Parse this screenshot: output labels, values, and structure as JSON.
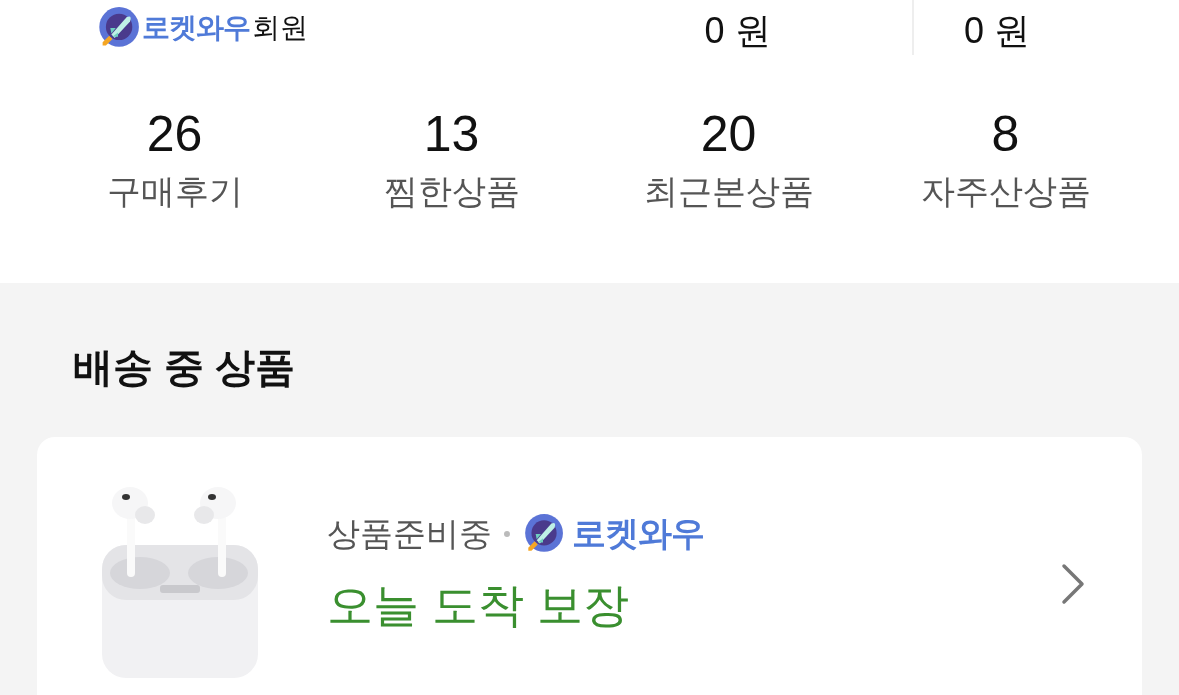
{
  "membership": {
    "brand": "로켓와우",
    "label": "회원"
  },
  "balances": [
    "0 원",
    "0 원"
  ],
  "stats": [
    {
      "count": "26",
      "label": "구매후기"
    },
    {
      "count": "13",
      "label": "찜한상품"
    },
    {
      "count": "20",
      "label": "최근본상품"
    },
    {
      "count": "8",
      "label": "자주산상품"
    }
  ],
  "section": {
    "title": "배송 중 상품"
  },
  "delivery": {
    "status": "상품준비중",
    "brand": "로켓와우",
    "promise": "오늘 도착 보장"
  }
}
